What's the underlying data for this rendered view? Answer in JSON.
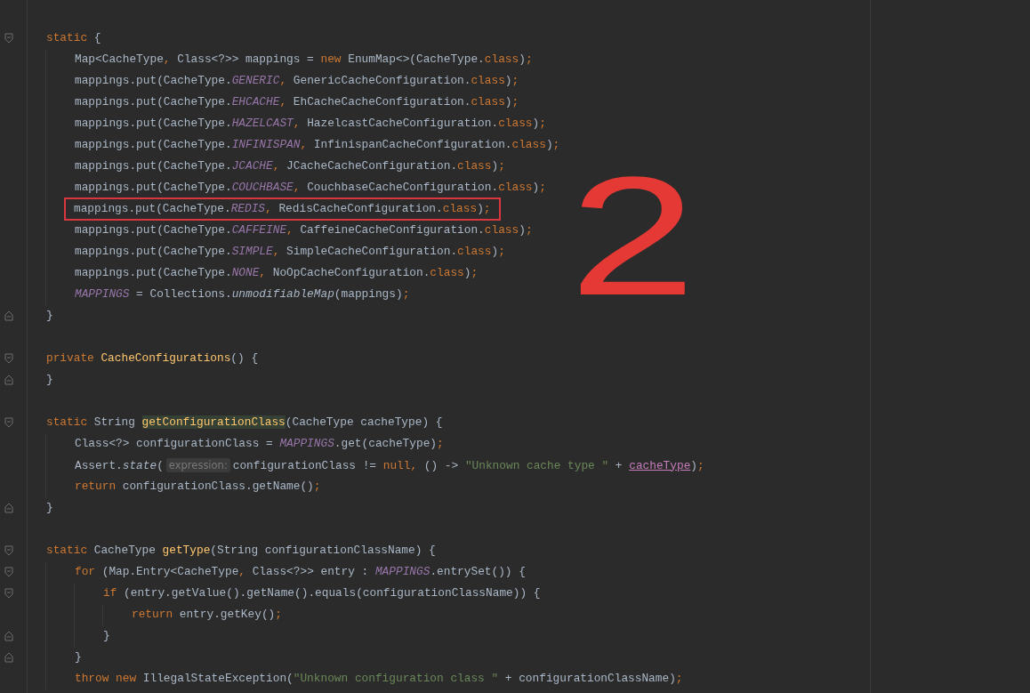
{
  "editor": {
    "annotation": "2",
    "lines": [
      {
        "kind": "code",
        "fold": {
          "kind": "open"
        },
        "boxed": false,
        "tokens": [
          {
            "kind": "kw",
            "text": "static"
          },
          {
            "kind": "plain",
            "text": " {"
          }
        ],
        "children": [
          {
            "kind": "code",
            "boxed": false,
            "tokens": [
              {
                "kind": "plain",
                "text": "Map<CacheType"
              },
              {
                "kind": "kw",
                "text": ","
              },
              {
                "kind": "plain",
                "text": " Class<?>> mappings = "
              },
              {
                "kind": "kw",
                "text": "new"
              },
              {
                "kind": "plain",
                "text": " EnumMap<>(CacheType."
              },
              {
                "kind": "kw",
                "text": "class"
              },
              {
                "kind": "plain",
                "text": ")"
              },
              {
                "kind": "kw",
                "text": ";"
              }
            ]
          },
          {
            "kind": "code",
            "boxed": false,
            "tokens": [
              {
                "kind": "plain",
                "text": "mappings.put(CacheType."
              },
              {
                "kind": "field",
                "text": "GENERIC"
              },
              {
                "kind": "kw",
                "text": ","
              },
              {
                "kind": "plain",
                "text": " GenericCacheConfiguration."
              },
              {
                "kind": "kw",
                "text": "class"
              },
              {
                "kind": "plain",
                "text": ")"
              },
              {
                "kind": "kw",
                "text": ";"
              }
            ]
          },
          {
            "kind": "code",
            "boxed": false,
            "tokens": [
              {
                "kind": "plain",
                "text": "mappings.put(CacheType."
              },
              {
                "kind": "field",
                "text": "EHCACHE"
              },
              {
                "kind": "kw",
                "text": ","
              },
              {
                "kind": "plain",
                "text": " EhCacheCacheConfiguration."
              },
              {
                "kind": "kw",
                "text": "class"
              },
              {
                "kind": "plain",
                "text": ")"
              },
              {
                "kind": "kw",
                "text": ";"
              }
            ]
          },
          {
            "kind": "code",
            "boxed": false,
            "tokens": [
              {
                "kind": "plain",
                "text": "mappings.put(CacheType."
              },
              {
                "kind": "field",
                "text": "HAZELCAST"
              },
              {
                "kind": "kw",
                "text": ","
              },
              {
                "kind": "plain",
                "text": " HazelcastCacheConfiguration."
              },
              {
                "kind": "kw",
                "text": "class"
              },
              {
                "kind": "plain",
                "text": ")"
              },
              {
                "kind": "kw",
                "text": ";"
              }
            ]
          },
          {
            "kind": "code",
            "boxed": false,
            "tokens": [
              {
                "kind": "plain",
                "text": "mappings.put(CacheType."
              },
              {
                "kind": "field",
                "text": "INFINISPAN"
              },
              {
                "kind": "kw",
                "text": ","
              },
              {
                "kind": "plain",
                "text": " InfinispanCacheConfiguration."
              },
              {
                "kind": "kw",
                "text": "class"
              },
              {
                "kind": "plain",
                "text": ")"
              },
              {
                "kind": "kw",
                "text": ";"
              }
            ]
          },
          {
            "kind": "code",
            "boxed": false,
            "tokens": [
              {
                "kind": "plain",
                "text": "mappings.put(CacheType."
              },
              {
                "kind": "field",
                "text": "JCACHE"
              },
              {
                "kind": "kw",
                "text": ","
              },
              {
                "kind": "plain",
                "text": " JCacheCacheConfiguration."
              },
              {
                "kind": "kw",
                "text": "class"
              },
              {
                "kind": "plain",
                "text": ")"
              },
              {
                "kind": "kw",
                "text": ";"
              }
            ]
          },
          {
            "kind": "code",
            "boxed": false,
            "tokens": [
              {
                "kind": "plain",
                "text": "mappings.put(CacheType."
              },
              {
                "kind": "field",
                "text": "COUCHBASE"
              },
              {
                "kind": "kw",
                "text": ","
              },
              {
                "kind": "plain",
                "text": " CouchbaseCacheConfiguration."
              },
              {
                "kind": "kw",
                "text": "class"
              },
              {
                "kind": "plain",
                "text": ")"
              },
              {
                "kind": "kw",
                "text": ";"
              }
            ]
          },
          {
            "kind": "code",
            "boxed": true,
            "tokens": [
              {
                "kind": "plain",
                "text": "mappings.put(CacheType."
              },
              {
                "kind": "field",
                "text": "REDIS"
              },
              {
                "kind": "kw",
                "text": ","
              },
              {
                "kind": "plain",
                "text": " RedisCacheConfiguration."
              },
              {
                "kind": "kw",
                "text": "class"
              },
              {
                "kind": "plain",
                "text": ")"
              },
              {
                "kind": "kw",
                "text": ";"
              }
            ]
          },
          {
            "kind": "code",
            "boxed": false,
            "tokens": [
              {
                "kind": "plain",
                "text": "mappings.put(CacheType."
              },
              {
                "kind": "field",
                "text": "CAFFEINE"
              },
              {
                "kind": "kw",
                "text": ","
              },
              {
                "kind": "plain",
                "text": " CaffeineCacheConfiguration."
              },
              {
                "kind": "kw",
                "text": "class"
              },
              {
                "kind": "plain",
                "text": ")"
              },
              {
                "kind": "kw",
                "text": ";"
              }
            ]
          },
          {
            "kind": "code",
            "boxed": false,
            "tokens": [
              {
                "kind": "plain",
                "text": "mappings.put(CacheType."
              },
              {
                "kind": "field",
                "text": "SIMPLE"
              },
              {
                "kind": "kw",
                "text": ","
              },
              {
                "kind": "plain",
                "text": " SimpleCacheConfiguration."
              },
              {
                "kind": "kw",
                "text": "class"
              },
              {
                "kind": "plain",
                "text": ")"
              },
              {
                "kind": "kw",
                "text": ";"
              }
            ]
          },
          {
            "kind": "code",
            "boxed": false,
            "tokens": [
              {
                "kind": "plain",
                "text": "mappings.put(CacheType."
              },
              {
                "kind": "field",
                "text": "NONE"
              },
              {
                "kind": "kw",
                "text": ","
              },
              {
                "kind": "plain",
                "text": " NoOpCacheConfiguration."
              },
              {
                "kind": "kw",
                "text": "class"
              },
              {
                "kind": "plain",
                "text": ")"
              },
              {
                "kind": "kw",
                "text": ";"
              }
            ]
          },
          {
            "kind": "code",
            "boxed": false,
            "tokens": [
              {
                "kind": "field",
                "text": "MAPPINGS"
              },
              {
                "kind": "plain",
                "text": " = Collections."
              },
              {
                "kind": "call",
                "text": "unmodifiableMap"
              },
              {
                "kind": "plain",
                "text": "(mappings)"
              },
              {
                "kind": "kw",
                "text": ";"
              }
            ]
          }
        ]
      },
      {
        "kind": "code",
        "fold": {
          "kind": "close"
        },
        "boxed": false,
        "tokens": [
          {
            "kind": "plain",
            "text": "}"
          }
        ]
      },
      {
        "kind": "blank"
      },
      {
        "kind": "code",
        "fold": {
          "kind": "open"
        },
        "boxed": false,
        "tokens": [
          {
            "kind": "kw",
            "text": "private "
          },
          {
            "kind": "decl",
            "text": "CacheConfigurations"
          },
          {
            "kind": "plain",
            "text": "() {"
          }
        ]
      },
      {
        "kind": "code",
        "fold": {
          "kind": "close"
        },
        "boxed": false,
        "tokens": [
          {
            "kind": "plain",
            "text": "}"
          }
        ]
      },
      {
        "kind": "blank"
      },
      {
        "kind": "code",
        "fold": {
          "kind": "open"
        },
        "boxed": false,
        "tokens": [
          {
            "kind": "kw",
            "text": "static"
          },
          {
            "kind": "plain",
            "text": " String "
          },
          {
            "kind": "decl-hit",
            "text": "getConfigurationClass"
          },
          {
            "kind": "plain",
            "text": "(CacheType cacheType) {"
          }
        ],
        "children": [
          {
            "kind": "code",
            "boxed": false,
            "tokens": [
              {
                "kind": "plain",
                "text": "Class<?> configurationClass = "
              },
              {
                "kind": "field",
                "text": "MAPPINGS"
              },
              {
                "kind": "plain",
                "text": ".get(cacheType)"
              },
              {
                "kind": "kw",
                "text": ";"
              }
            ]
          },
          {
            "kind": "code",
            "boxed": false,
            "tokens": [
              {
                "kind": "plain",
                "text": "Assert."
              },
              {
                "kind": "call",
                "text": "state"
              },
              {
                "kind": "plain",
                "text": "("
              },
              {
                "kind": "hint",
                "text": "expression:"
              },
              {
                "kind": "plain",
                "text": "configurationClass != "
              },
              {
                "kind": "kw",
                "text": "null,"
              },
              {
                "kind": "plain",
                "text": " () -> "
              },
              {
                "kind": "string",
                "text": "\"Unknown cache type \""
              },
              {
                "kind": "plain",
                "text": " + "
              },
              {
                "kind": "ref",
                "text": "cacheType"
              },
              {
                "kind": "plain",
                "text": ")"
              },
              {
                "kind": "kw",
                "text": ";"
              }
            ]
          },
          {
            "kind": "code",
            "boxed": false,
            "tokens": [
              {
                "kind": "kw",
                "text": "return"
              },
              {
                "kind": "plain",
                "text": " configurationClass.getName()"
              },
              {
                "kind": "kw",
                "text": ";"
              }
            ]
          }
        ]
      },
      {
        "kind": "code",
        "fold": {
          "kind": "close"
        },
        "boxed": false,
        "tokens": [
          {
            "kind": "plain",
            "text": "}"
          }
        ]
      },
      {
        "kind": "blank"
      },
      {
        "kind": "code",
        "fold": {
          "kind": "open"
        },
        "boxed": false,
        "tokens": [
          {
            "kind": "kw",
            "text": "static"
          },
          {
            "kind": "plain",
            "text": " CacheType "
          },
          {
            "kind": "decl",
            "text": "getType"
          },
          {
            "kind": "plain",
            "text": "(String configurationClassName) {"
          }
        ],
        "children": [
          {
            "kind": "code",
            "fold": {
              "kind": "open"
            },
            "boxed": false,
            "tokens": [
              {
                "kind": "kw",
                "text": "for"
              },
              {
                "kind": "plain",
                "text": " (Map.Entry<CacheType"
              },
              {
                "kind": "kw",
                "text": ","
              },
              {
                "kind": "plain",
                "text": " Class<?>> entry : "
              },
              {
                "kind": "field",
                "text": "MAPPINGS"
              },
              {
                "kind": "plain",
                "text": ".entrySet()) {"
              }
            ],
            "children": [
              {
                "kind": "code",
                "fold": {
                  "kind": "open"
                },
                "boxed": false,
                "tokens": [
                  {
                    "kind": "kw",
                    "text": "if"
                  },
                  {
                    "kind": "plain",
                    "text": " (entry.getValue().getName().equals(configurationClassName)) {"
                  }
                ],
                "children": [
                  {
                    "kind": "code",
                    "boxed": false,
                    "tokens": [
                      {
                        "kind": "kw",
                        "text": "return"
                      },
                      {
                        "kind": "plain",
                        "text": " entry.getKey()"
                      },
                      {
                        "kind": "kw",
                        "text": ";"
                      }
                    ]
                  }
                ]
              },
              {
                "kind": "code",
                "fold": {
                  "kind": "close"
                },
                "boxed": false,
                "tokens": [
                  {
                    "kind": "plain",
                    "text": "}"
                  }
                ]
              }
            ]
          },
          {
            "kind": "code",
            "fold": {
              "kind": "close"
            },
            "boxed": false,
            "tokens": [
              {
                "kind": "plain",
                "text": "}"
              }
            ]
          },
          {
            "kind": "code",
            "boxed": false,
            "tokens": [
              {
                "kind": "kw",
                "text": "throw new"
              },
              {
                "kind": "plain",
                "text": " IllegalStateException("
              },
              {
                "kind": "string",
                "text": "\"Unknown configuration class \""
              },
              {
                "kind": "plain",
                "text": " + configurationClassName)"
              },
              {
                "kind": "kw",
                "text": ";"
              }
            ]
          }
        ]
      }
    ]
  }
}
